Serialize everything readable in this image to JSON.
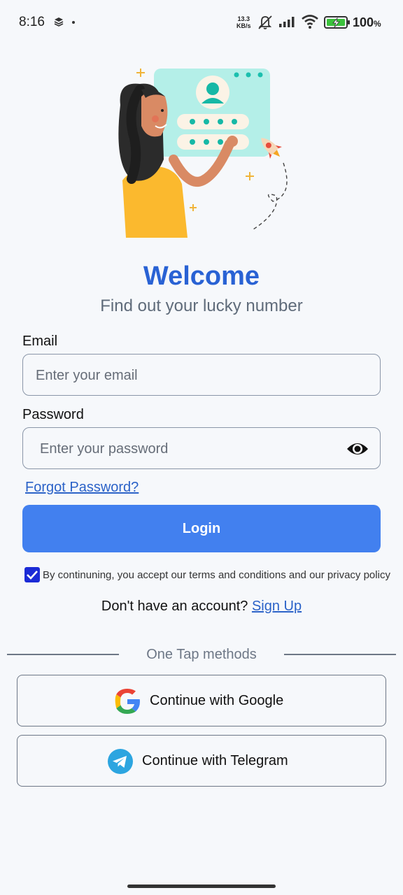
{
  "status_bar": {
    "time": "8:16",
    "speed_value": "13.3",
    "speed_unit": "KB/s",
    "battery_value": "100",
    "battery_unit": "%"
  },
  "welcome": {
    "title": "Welcome",
    "subtitle": "Find out your lucky number"
  },
  "form": {
    "email_label": "Email",
    "email_placeholder": "Enter your email",
    "password_label": "Password",
    "password_placeholder": "Enter your password",
    "forgot_password": "Forgot Password?",
    "login_label": "Login",
    "terms_checked": true,
    "terms_text": "By continuning, you accept our terms and conditions and our privacy policy"
  },
  "signup": {
    "prompt": "Don't have an account?",
    "link": "Sign Up"
  },
  "one_tap": {
    "divider_text": "One Tap methods",
    "google_label": "Continue with Google",
    "telegram_label": "Continue with Telegram"
  },
  "colors": {
    "accent": "#4280ef",
    "title": "#2962d4",
    "link": "#2b62c8",
    "checkbox": "#1b2bd6",
    "background": "#f6f8fb"
  },
  "icons": [
    "layers-icon",
    "mute-icon",
    "signal-icon",
    "wifi-icon",
    "battery-charging-icon",
    "eye-icon",
    "check-icon",
    "google-icon",
    "telegram-icon"
  ]
}
